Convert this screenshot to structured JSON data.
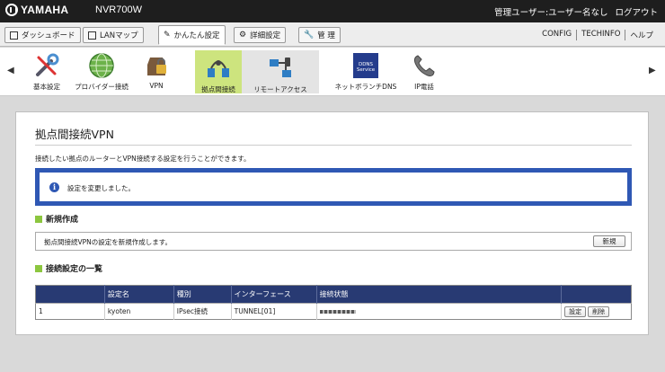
{
  "header": {
    "brand": "YAMAHA",
    "model": "NVR700W",
    "user": "管理ユーザー:ユーザー名なし",
    "logout": "ログアウト"
  },
  "tabs": [
    {
      "label": "ダッシュボード",
      "icon": "dashboard-icon"
    },
    {
      "label": "LANマップ",
      "icon": "lan-map-icon"
    },
    {
      "label": "かんたん設定",
      "icon": "easy-setup-icon",
      "active": true
    },
    {
      "label": "詳細設定",
      "icon": "gear-icon"
    },
    {
      "label": "管 理",
      "icon": "wrench-icon"
    }
  ],
  "tabs_right": [
    "CONFIG",
    "TECHINFO",
    "ヘルプ"
  ],
  "iconbar": {
    "items": [
      {
        "label": "基本設定",
        "icon": "tools-icon"
      },
      {
        "label": "プロバイダー接続",
        "icon": "globe-icon"
      },
      {
        "label": "VPN",
        "icon": "vpn-lock-icon"
      },
      {
        "label": "拠点間接続",
        "icon": "site-to-site-icon",
        "selected": true
      },
      {
        "label": "リモートアクセス",
        "icon": "remote-access-icon"
      },
      {
        "label": "ネットボランチDNS",
        "icon": "ddns-service-icon"
      },
      {
        "label": "IP電話",
        "icon": "phone-icon"
      }
    ],
    "ddns_badge": [
      "DDNS",
      "Service"
    ]
  },
  "page": {
    "title": "拠点間接続VPN",
    "description": "接続したい拠点のルーターとVPN接続する設定を行うことができます。",
    "notice": "設定を変更しました。"
  },
  "new_section": {
    "heading": "新規作成",
    "text": "拠点間接続VPNの設定を新規作成します。",
    "button": "新規"
  },
  "list_section": {
    "heading": "接続設定の一覧",
    "columns": [
      "",
      "設定名",
      "種別",
      "インターフェース",
      "接続状態",
      ""
    ],
    "rows": [
      {
        "no": "1",
        "name": "kyoten",
        "type": "IPsec接続",
        "interface": "TUNNEL[01]",
        "edit": "設定",
        "delete": "削除"
      }
    ]
  },
  "colors": {
    "topbar": "#1e1e1e",
    "selected_item": "#cde47e",
    "notice_border": "#2f58b4",
    "table_header": "#283a73",
    "section_marker": "#8cc63f"
  }
}
